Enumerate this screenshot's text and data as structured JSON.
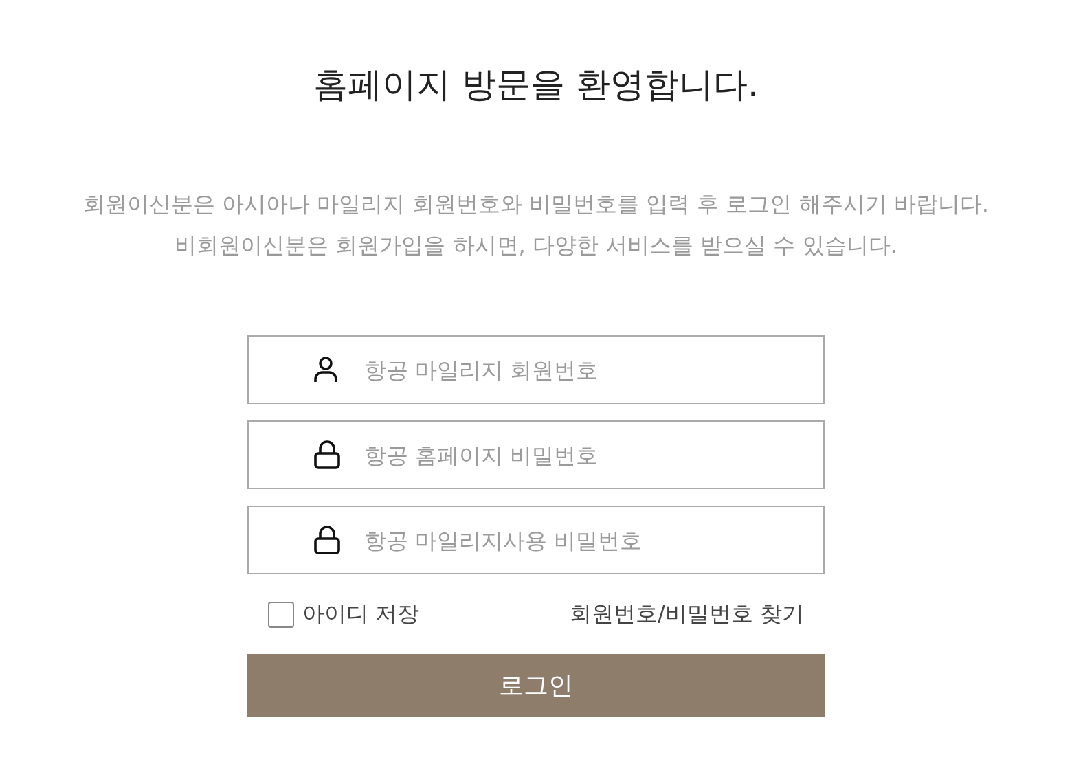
{
  "title": "홈페이지 방문을 환영합니다.",
  "intro": [
    "회원이신분은 아시아나 마일리지 회원번호와 비밀번호를 입력 후 로그인 해주시기 바랍니다.",
    "비회원이신분은 회원가입을 하시면, 다양한 서비스를 받으실 수 있습니다."
  ],
  "fields": [
    {
      "kind": "user",
      "placeholder": "항공 마일리지 회원번호"
    },
    {
      "kind": "lock",
      "placeholder": "항공 홈페이지 비밀번호"
    },
    {
      "kind": "lock",
      "placeholder": "항공 마일리지사용 비밀번호"
    }
  ],
  "remember": {
    "label": "아이디 저장",
    "checked": false
  },
  "find_link": "회원번호/비밀번호 찾기",
  "login_button": "로그인"
}
